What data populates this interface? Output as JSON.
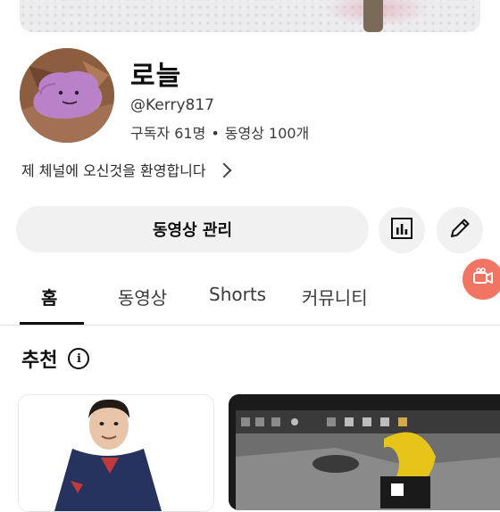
{
  "channel": {
    "name": "로늘",
    "handle": "@Kerry817",
    "subscribers": "구독자 61명",
    "separator": "•",
    "videos": "동영상 100개",
    "description": "제 체널에 오신것을 환영합니다"
  },
  "actions": {
    "manage_label": "동영상 관리"
  },
  "tabs": [
    {
      "label": "홈",
      "active": true
    },
    {
      "label": "동영상",
      "active": false
    },
    {
      "label": "Shorts",
      "active": false
    },
    {
      "label": "커뮤니티",
      "active": false
    }
  ],
  "section": {
    "title": "추천",
    "info_symbol": "i"
  },
  "colors": {
    "accent_fab": "#f07563",
    "button_bg": "#f1f1f1",
    "text": "#0f0f0f"
  },
  "icons": [
    "analytics-icon",
    "edit-pencil-icon",
    "video-camera-icon",
    "chevron-right-icon",
    "info-icon"
  ]
}
